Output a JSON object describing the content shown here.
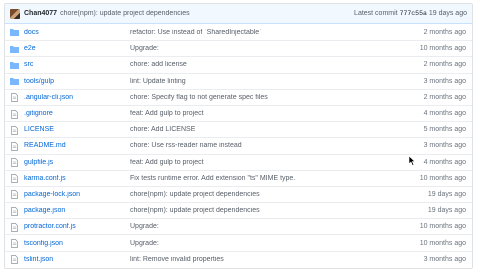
{
  "commit": {
    "author": "Chan4077",
    "message": "chore(npm): update project dependencies",
    "latest_label": "Latest commit",
    "sha": "777c55a",
    "age": "19 days ago"
  },
  "files": [
    {
      "name": "docs",
      "type": "folder",
      "message": "refactor: Use instead of `SharedInjectable`",
      "age": "2 months ago"
    },
    {
      "name": "e2e",
      "type": "folder",
      "message": "Upgrade:",
      "age": "10 months ago"
    },
    {
      "name": "src",
      "type": "folder",
      "message": "chore: add license",
      "age": "2 months ago"
    },
    {
      "name": "tools/gulp",
      "type": "folder",
      "message": "lint: Update linting",
      "age": "3 months ago"
    },
    {
      "name": ".angular-cli.json",
      "type": "file",
      "message": "chore: Specify flag to not generate spec files",
      "age": "2 months ago"
    },
    {
      "name": ".gitignore",
      "type": "file",
      "message": "feat: Add gulp to project",
      "age": "4 months ago"
    },
    {
      "name": "LICENSE",
      "type": "file",
      "message": "chore: Add LICENSE",
      "age": "5 months ago"
    },
    {
      "name": "README.md",
      "type": "file",
      "message": "chore: Use rss-reader name instead",
      "age": "3 months ago"
    },
    {
      "name": "gulpfile.js",
      "type": "file",
      "message": "feat: Add gulp to project",
      "age": "4 months ago"
    },
    {
      "name": "karma.conf.js",
      "type": "file",
      "message": "Fix tests runtime error. Add extension \"ts\" MIME type.",
      "age": "10 months ago"
    },
    {
      "name": "package-lock.json",
      "type": "file",
      "message": "chore(npm): update project dependencies",
      "age": "19 days ago"
    },
    {
      "name": "package.json",
      "type": "file",
      "message": "chore(npm): update project dependencies",
      "age": "19 days ago"
    },
    {
      "name": "protractor.conf.js",
      "type": "file",
      "message": "Upgrade:",
      "age": "10 months ago"
    },
    {
      "name": "tsconfig.json",
      "type": "file",
      "message": "Upgrade:",
      "age": "10 months ago"
    },
    {
      "name": "tslint.json",
      "type": "file",
      "message": "lint: Remove invalid properties",
      "age": "3 months ago"
    }
  ]
}
